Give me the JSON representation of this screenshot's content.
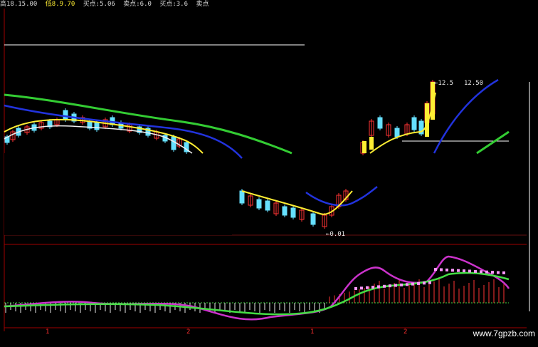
{
  "header": {
    "items": [
      {
        "text": "高18.15.00",
        "color": "#d8d8d8"
      },
      {
        "text": "低8.9.70",
        "color": "#ffee33"
      },
      {
        "text": "买点:5.06",
        "color": "#d8d8d8"
      },
      {
        "text": "卖点:6.0",
        "color": "#d8d8d8"
      },
      {
        "text": "买点:3.6",
        "color": "#d8d8d8"
      },
      {
        "text": "卖点",
        "color": "#d8d8d8"
      }
    ]
  },
  "labels": {
    "high_price": "12.50",
    "low_price": "0.01",
    "high_marker": "←12.5",
    "low_marker": "←0.01"
  },
  "ticks": [
    "1",
    "2",
    "1",
    "2"
  ],
  "watermark": "www.7gpzb.com",
  "colors": {
    "green_ma": "#33cc33",
    "blue_ma": "#2233dd",
    "yellow_ma": "#ffee33",
    "white_line": "#f0f0f0",
    "candle_down": "#66e0ff",
    "candle_up": "#ff3333",
    "indicator_pink": "#cc33cc",
    "indicator_green": "#44dd44",
    "dots": "#ff99ff",
    "separator": "#a00000"
  }
}
